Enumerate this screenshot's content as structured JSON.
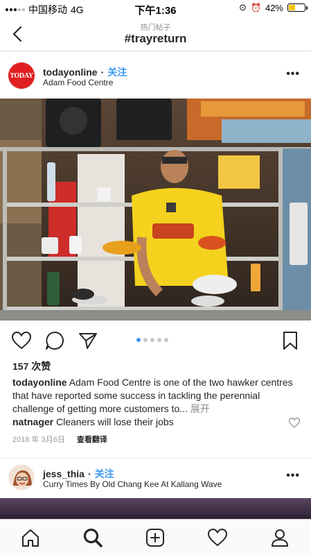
{
  "status_bar": {
    "carrier": "中国移动",
    "network": "4G",
    "time": "下午1:36",
    "battery": "42%",
    "battery_level": 0.42
  },
  "header": {
    "subtitle": "热门帖子",
    "title": "#trayreturn"
  },
  "post": {
    "avatar_text": "TODAY",
    "username": "todayonline",
    "separator": "·",
    "follow_label": "关注",
    "location": "Adam Food Centre",
    "more_label": "•••",
    "carousel_pages": 5,
    "carousel_active": 1,
    "likes": "157 次赞",
    "caption_user": "todayonline",
    "caption_text": "Adam Food Centre is one of the two hawker centres that have reported some success in tackling the perennial challenge of getting more customers to...",
    "caption_more": "展开",
    "comment_user": "natnager",
    "comment_text": "Cleaners will lose their jobs",
    "date": "2018 年 3月6日",
    "translate_label": "查看翻译"
  },
  "post2": {
    "username": "jess_thia",
    "separator": "·",
    "follow_label": "关注",
    "location": "Curry Times By Old Chang Kee At Kallang Wave",
    "more_label": "•••"
  },
  "tabbar": {
    "items": [
      "home-icon",
      "search-icon",
      "add-post-icon",
      "activity-heart-icon",
      "profile-icon"
    ]
  },
  "colors": {
    "accent_blue": "#3897f0",
    "today_red": "#e02020",
    "text": "#262626"
  }
}
